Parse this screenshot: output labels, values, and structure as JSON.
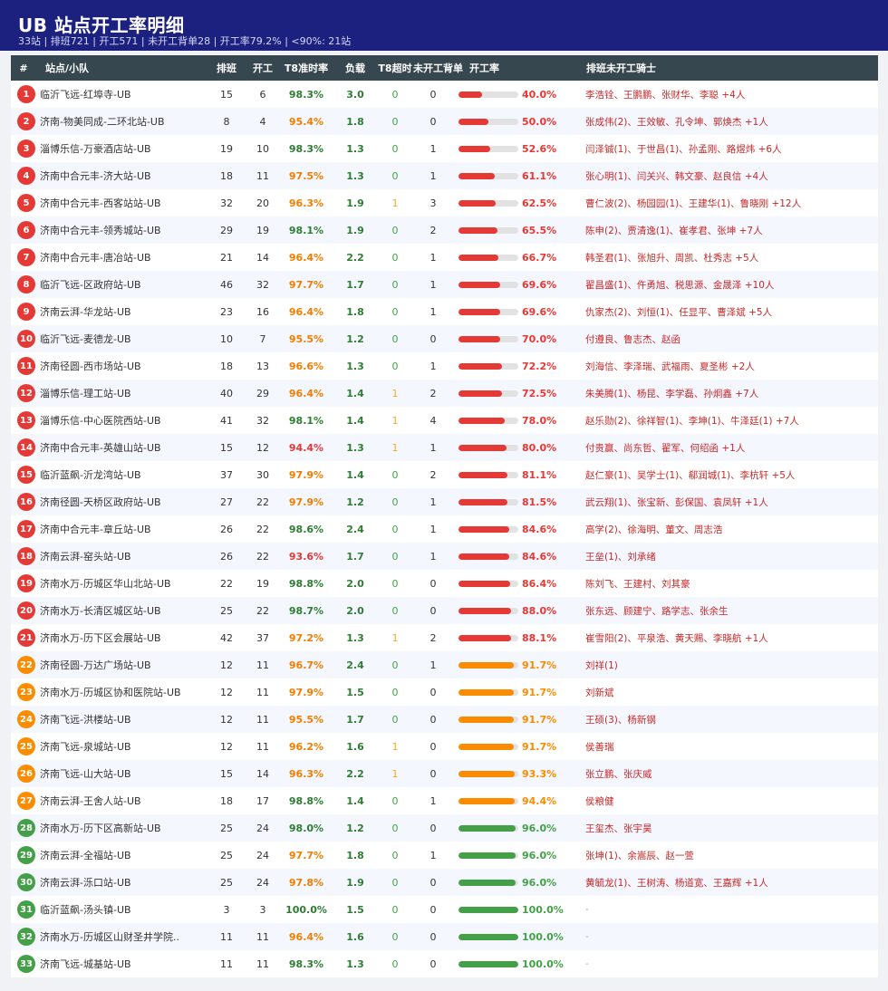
{
  "header": {
    "title": "UB 站点开工率明细",
    "subtitle": "33站 | 排班721 | 开工571 | 未开工背单28 | 开工率79.2% | <90%: 21站"
  },
  "columns": {
    "num": "#",
    "name": "站点/小队",
    "sched": "排班",
    "open": "开工",
    "t8": "T8准时率",
    "load": "负载",
    "over": "T8超时",
    "backlog": "未开工背单",
    "rate": "开工率",
    "riders": "排班未开工骑士"
  },
  "colors": {
    "red": "#e53935",
    "orange": "#fb8c00",
    "green": "#43a047",
    "t8_green": "#2e7d32",
    "t8_orange": "#f57c00",
    "t8_red": "#e53935"
  },
  "rows": [
    {
      "num": "1",
      "name": "临沂飞远-红埠寺-UB",
      "sched": "15",
      "open": "6",
      "t8": "98.3%",
      "load": "3.0",
      "over": "0",
      "backlog": "0",
      "rate": "40.0%",
      "riders": "李浩铨、王鹏鹏、张财华、李聪 +4人",
      "tier": "red",
      "t8tier": "green",
      "pct": 40.0
    },
    {
      "num": "2",
      "name": "济南-物美同成-二环北站-UB",
      "sched": "8",
      "open": "4",
      "t8": "95.4%",
      "load": "1.8",
      "over": "0",
      "backlog": "0",
      "rate": "50.0%",
      "riders": "张成伟(2)、王效敏、孔令坤、郭焕杰 +1人",
      "tier": "red",
      "t8tier": "orange",
      "pct": 50.0
    },
    {
      "num": "3",
      "name": "淄博乐信-万豪酒店站-UB",
      "sched": "19",
      "open": "10",
      "t8": "98.3%",
      "load": "1.3",
      "over": "0",
      "backlog": "1",
      "rate": "52.6%",
      "riders": "闫泽铖(1)、于世昌(1)、孙孟刚、路煜炜 +6人",
      "tier": "red",
      "t8tier": "green",
      "pct": 52.6
    },
    {
      "num": "4",
      "name": "济南中合元丰-济大站-UB",
      "sched": "18",
      "open": "11",
      "t8": "97.5%",
      "load": "1.3",
      "over": "0",
      "backlog": "1",
      "rate": "61.1%",
      "riders": "张心明(1)、闫关兴、韩文豪、赵良信 +4人",
      "tier": "red",
      "t8tier": "orange",
      "pct": 61.1
    },
    {
      "num": "5",
      "name": "济南中合元丰-西客站站-UB",
      "sched": "32",
      "open": "20",
      "t8": "96.3%",
      "load": "1.9",
      "over": "1",
      "backlog": "3",
      "rate": "62.5%",
      "riders": "曹仁波(2)、杨园园(1)、王建华(1)、鲁晓刚 +12人",
      "tier": "red",
      "t8tier": "orange",
      "pct": 62.5
    },
    {
      "num": "6",
      "name": "济南中合元丰-领秀城站-UB",
      "sched": "29",
      "open": "19",
      "t8": "98.1%",
      "load": "1.9",
      "over": "0",
      "backlog": "2",
      "rate": "65.5%",
      "riders": "陈申(2)、贾清逸(1)、崔孝君、张坤 +7人",
      "tier": "red",
      "t8tier": "green",
      "pct": 65.5
    },
    {
      "num": "7",
      "name": "济南中合元丰-唐冶站-UB",
      "sched": "21",
      "open": "14",
      "t8": "96.4%",
      "load": "2.2",
      "over": "0",
      "backlog": "1",
      "rate": "66.7%",
      "riders": "韩圣君(1)、张旭升、周凯、杜秀志 +5人",
      "tier": "red",
      "t8tier": "orange",
      "pct": 66.7
    },
    {
      "num": "8",
      "name": "临沂飞远-区政府站-UB",
      "sched": "46",
      "open": "32",
      "t8": "97.7%",
      "load": "1.7",
      "over": "0",
      "backlog": "1",
      "rate": "69.6%",
      "riders": "翟昌盛(1)、仵勇旭、税思源、金晟泽 +10人",
      "tier": "red",
      "t8tier": "orange",
      "pct": 69.6
    },
    {
      "num": "9",
      "name": "济南云湃-华龙站-UB",
      "sched": "23",
      "open": "16",
      "t8": "96.4%",
      "load": "1.8",
      "over": "0",
      "backlog": "1",
      "rate": "69.6%",
      "riders": "仇家杰(2)、刘恒(1)、任显平、曹泽斌 +5人",
      "tier": "red",
      "t8tier": "orange",
      "pct": 69.6
    },
    {
      "num": "10",
      "name": "临沂飞远-麦德龙-UB",
      "sched": "10",
      "open": "7",
      "t8": "95.5%",
      "load": "1.2",
      "over": "0",
      "backlog": "0",
      "rate": "70.0%",
      "riders": "付遵良、鲁志杰、赵函",
      "tier": "red",
      "t8tier": "orange",
      "pct": 70.0
    },
    {
      "num": "11",
      "name": "济南径圆-西市场站-UB",
      "sched": "18",
      "open": "13",
      "t8": "96.6%",
      "load": "1.3",
      "over": "0",
      "backlog": "1",
      "rate": "72.2%",
      "riders": "刘海信、李泽瑞、武福雨、夏圣彬 +2人",
      "tier": "red",
      "t8tier": "orange",
      "pct": 72.2
    },
    {
      "num": "12",
      "name": "淄博乐信-理工站-UB",
      "sched": "40",
      "open": "29",
      "t8": "96.4%",
      "load": "1.4",
      "over": "1",
      "backlog": "2",
      "rate": "72.5%",
      "riders": "朱美腾(1)、杨昆、李学磊、孙炯鑫 +7人",
      "tier": "red",
      "t8tier": "orange",
      "pct": 72.5
    },
    {
      "num": "13",
      "name": "淄博乐信-中心医院西站-UB",
      "sched": "41",
      "open": "32",
      "t8": "98.1%",
      "load": "1.4",
      "over": "1",
      "backlog": "4",
      "rate": "78.0%",
      "riders": "赵乐勋(2)、徐祥智(1)、李坤(1)、牛泽廷(1) +7人",
      "tier": "red",
      "t8tier": "green",
      "pct": 78.0
    },
    {
      "num": "14",
      "name": "济南中合元丰-英雄山站-UB",
      "sched": "15",
      "open": "12",
      "t8": "94.4%",
      "load": "1.3",
      "over": "1",
      "backlog": "1",
      "rate": "80.0%",
      "riders": "付贵赢、尚东哲、翟军、何绍函 +1人",
      "tier": "red",
      "t8tier": "red",
      "pct": 80.0
    },
    {
      "num": "15",
      "name": "临沂蓝飙-沂龙湾站-UB",
      "sched": "37",
      "open": "30",
      "t8": "97.9%",
      "load": "1.4",
      "over": "0",
      "backlog": "2",
      "rate": "81.1%",
      "riders": "赵仁豪(1)、吴学士(1)、郗润城(1)、李杭轩 +5人",
      "tier": "red",
      "t8tier": "orange",
      "pct": 81.1
    },
    {
      "num": "16",
      "name": "济南径圆-天桥区政府站-UB",
      "sched": "27",
      "open": "22",
      "t8": "97.9%",
      "load": "1.2",
      "over": "0",
      "backlog": "1",
      "rate": "81.5%",
      "riders": "武云翔(1)、张宝新、彭保国、袁凤轩 +1人",
      "tier": "red",
      "t8tier": "orange",
      "pct": 81.5
    },
    {
      "num": "17",
      "name": "济南中合元丰-章丘站-UB",
      "sched": "26",
      "open": "22",
      "t8": "98.6%",
      "load": "2.4",
      "over": "0",
      "backlog": "1",
      "rate": "84.6%",
      "riders": "高学(2)、徐海明、董文、周志浩",
      "tier": "red",
      "t8tier": "green",
      "pct": 84.6
    },
    {
      "num": "18",
      "name": "济南云湃-窑头站-UB",
      "sched": "26",
      "open": "22",
      "t8": "93.6%",
      "load": "1.7",
      "over": "0",
      "backlog": "1",
      "rate": "84.6%",
      "riders": "王垒(1)、刘承绪",
      "tier": "red",
      "t8tier": "red",
      "pct": 84.6
    },
    {
      "num": "19",
      "name": "济南水万-历城区华山北站-UB",
      "sched": "22",
      "open": "19",
      "t8": "98.8%",
      "load": "2.0",
      "over": "0",
      "backlog": "0",
      "rate": "86.4%",
      "riders": "陈刘飞、王建村、刘其豪",
      "tier": "red",
      "t8tier": "green",
      "pct": 86.4
    },
    {
      "num": "20",
      "name": "济南水万-长清区城区站-UB",
      "sched": "25",
      "open": "22",
      "t8": "98.7%",
      "load": "2.0",
      "over": "0",
      "backlog": "0",
      "rate": "88.0%",
      "riders": "张东远、顾建宁、路学志、张余生",
      "tier": "red",
      "t8tier": "green",
      "pct": 88.0
    },
    {
      "num": "21",
      "name": "济南水万-历下区会展站-UB",
      "sched": "42",
      "open": "37",
      "t8": "97.2%",
      "load": "1.3",
      "over": "1",
      "backlog": "2",
      "rate": "88.1%",
      "riders": "崔雪阳(2)、平泉浩、黄天赐、李晓航 +1人",
      "tier": "red",
      "t8tier": "orange",
      "pct": 88.1
    },
    {
      "num": "22",
      "name": "济南径圆-万达广场站-UB",
      "sched": "12",
      "open": "11",
      "t8": "96.7%",
      "load": "2.4",
      "over": "0",
      "backlog": "1",
      "rate": "91.7%",
      "riders": "刘祥(1)",
      "tier": "orange",
      "t8tier": "orange",
      "pct": 91.7
    },
    {
      "num": "23",
      "name": "济南水万-历城区协和医院站-UB",
      "sched": "12",
      "open": "11",
      "t8": "97.9%",
      "load": "1.5",
      "over": "0",
      "backlog": "0",
      "rate": "91.7%",
      "riders": "刘新斌",
      "tier": "orange",
      "t8tier": "orange",
      "pct": 91.7
    },
    {
      "num": "24",
      "name": "济南飞远-洪楼站-UB",
      "sched": "12",
      "open": "11",
      "t8": "95.5%",
      "load": "1.7",
      "over": "0",
      "backlog": "0",
      "rate": "91.7%",
      "riders": "王硕(3)、杨新钢",
      "tier": "orange",
      "t8tier": "orange",
      "pct": 91.7
    },
    {
      "num": "25",
      "name": "济南飞远-泉城站-UB",
      "sched": "12",
      "open": "11",
      "t8": "96.2%",
      "load": "1.6",
      "over": "1",
      "backlog": "0",
      "rate": "91.7%",
      "riders": "侯善瑞",
      "tier": "orange",
      "t8tier": "orange",
      "pct": 91.7
    },
    {
      "num": "26",
      "name": "济南飞远-山大站-UB",
      "sched": "15",
      "open": "14",
      "t8": "96.3%",
      "load": "2.2",
      "over": "1",
      "backlog": "0",
      "rate": "93.3%",
      "riders": "张立鹏、张庆威",
      "tier": "orange",
      "t8tier": "orange",
      "pct": 93.3
    },
    {
      "num": "27",
      "name": "济南云湃-王舍人站-UB",
      "sched": "18",
      "open": "17",
      "t8": "98.8%",
      "load": "1.4",
      "over": "0",
      "backlog": "1",
      "rate": "94.4%",
      "riders": "侯粮健",
      "tier": "orange",
      "t8tier": "green",
      "pct": 94.4
    },
    {
      "num": "28",
      "name": "济南水万-历下区高新站-UB",
      "sched": "25",
      "open": "24",
      "t8": "98.0%",
      "load": "1.2",
      "over": "0",
      "backlog": "0",
      "rate": "96.0%",
      "riders": "王玺杰、张宇昊",
      "tier": "green",
      "t8tier": "green",
      "pct": 96.0
    },
    {
      "num": "29",
      "name": "济南云湃-全福站-UB",
      "sched": "25",
      "open": "24",
      "t8": "97.7%",
      "load": "1.8",
      "over": "0",
      "backlog": "1",
      "rate": "96.0%",
      "riders": "张坤(1)、余嵩辰、赵一萱",
      "tier": "green",
      "t8tier": "orange",
      "pct": 96.0
    },
    {
      "num": "30",
      "name": "济南云湃-泺口站-UB",
      "sched": "25",
      "open": "24",
      "t8": "97.8%",
      "load": "1.9",
      "over": "0",
      "backlog": "0",
      "rate": "96.0%",
      "riders": "黄毓龙(1)、王树涛、杨道宽、王嘉辉 +1人",
      "tier": "green",
      "t8tier": "orange",
      "pct": 96.0
    },
    {
      "num": "31",
      "name": "临沂蓝飙-汤头镇-UB",
      "sched": "3",
      "open": "3",
      "t8": "100.0%",
      "load": "1.5",
      "over": "0",
      "backlog": "0",
      "rate": "100.0%",
      "riders": "-",
      "tier": "green",
      "t8tier": "green",
      "pct": 100.0
    },
    {
      "num": "32",
      "name": "济南水万-历城区山财圣井学院..",
      "sched": "11",
      "open": "11",
      "t8": "96.4%",
      "load": "1.6",
      "over": "0",
      "backlog": "0",
      "rate": "100.0%",
      "riders": "-",
      "tier": "green",
      "t8tier": "orange",
      "pct": 100.0
    },
    {
      "num": "33",
      "name": "济南飞远-城基站-UB",
      "sched": "11",
      "open": "11",
      "t8": "98.3%",
      "load": "1.3",
      "over": "0",
      "backlog": "0",
      "rate": "100.0%",
      "riders": "-",
      "tier": "green",
      "t8tier": "green",
      "pct": 100.0
    }
  ]
}
